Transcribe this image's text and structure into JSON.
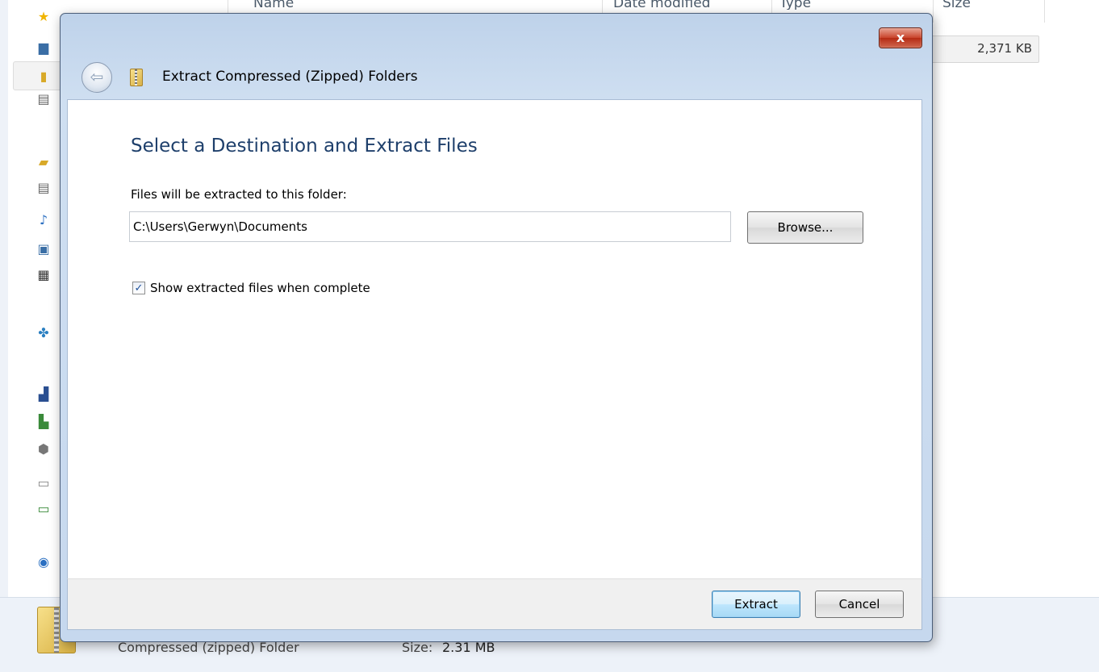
{
  "explorer": {
    "columns": {
      "name": "Name",
      "date_modified": "Date modified",
      "type": "Type",
      "size": "Size"
    },
    "selected_file_size": "2,371 KB",
    "details": {
      "type": "Compressed (zipped) Folder",
      "size_label": "Size:",
      "size_value": "2.31 MB"
    }
  },
  "dialog": {
    "title": "Extract Compressed (Zipped) Folders",
    "close_glyph": "x",
    "heading": "Select a Destination and Extract Files",
    "destination_label": "Files will be extracted to this folder:",
    "destination_value": "C:\\Users\\Gerwyn\\Documents",
    "browse_label": "Browse...",
    "show_files_label": "Show extracted files when complete",
    "show_files_checked": true,
    "extract_label": "Extract",
    "cancel_label": "Cancel"
  },
  "icons": {
    "back": "back-arrow-icon",
    "zip": "zip-folder-icon",
    "close": "close-icon"
  }
}
